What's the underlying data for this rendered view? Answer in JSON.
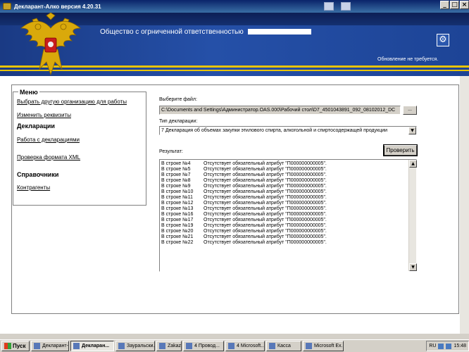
{
  "window": {
    "title": "Декларант-Алко версия 4.20.31",
    "controls": {
      "minimize": "_",
      "maximize": "□",
      "close": "×"
    }
  },
  "header": {
    "org_prefix": "Общество с огрниченной ответственностью",
    "update_status": "Обновление не требуется."
  },
  "menu": {
    "legend": "Меню",
    "items": [
      {
        "label": "Выбрать другую организацию для работы",
        "type": "link"
      },
      {
        "label": "Изменить реквизиты",
        "type": "link"
      },
      {
        "label": "Декларации",
        "type": "heading"
      },
      {
        "label": "Работа с декларациями",
        "type": "link"
      },
      {
        "label": "Проверка формата XML",
        "type": "link"
      },
      {
        "label": "Справочники",
        "type": "heading"
      },
      {
        "label": "Контрагенты",
        "type": "link"
      }
    ]
  },
  "form": {
    "file_label": "Выберите файл:",
    "file_value": "C:\\Documents and Settings\\Администратор.OAS.000\\Рабочий стол\\D7_4501043891_092_08102012_DC",
    "browse_label": "...",
    "type_label": "Тип декларации:",
    "type_value": "7 Декларация об объемах закупки этилового спирта, алкогольной и спиртосодержащей продукции",
    "results_label": "Результат:",
    "check_button": "Проверить"
  },
  "results": [
    {
      "row": "В строке №4",
      "message": "Отсутствует обязательный атрибут \"П000000000005\"."
    },
    {
      "row": "В строке №5",
      "message": "Отсутствует обязательный атрибут \"П000000000005\"."
    },
    {
      "row": "В строке №7",
      "message": "Отсутствует обязательный атрибут \"П000000000005\"."
    },
    {
      "row": "В строке №8",
      "message": "Отсутствует обязательный атрибут \"П000000000005\"."
    },
    {
      "row": "В строке №9",
      "message": "Отсутствует обязательный атрибут \"П000000000005\"."
    },
    {
      "row": "В строке №10",
      "message": "Отсутствует обязательный атрибут \"П000000000005\"."
    },
    {
      "row": "В строке №11",
      "message": "Отсутствует обязательный атрибут \"П000000000005\"."
    },
    {
      "row": "В строке №12",
      "message": "Отсутствует обязательный атрибут \"П000000000005\"."
    },
    {
      "row": "В строке №13",
      "message": "Отсутствует обязательный атрибут \"П000000000005\"."
    },
    {
      "row": "В строке №16",
      "message": "Отсутствует обязательный атрибут \"П000000000005\"."
    },
    {
      "row": "В строке №17",
      "message": "Отсутствует обязательный атрибут \"П000000000005\"."
    },
    {
      "row": "В строке №19",
      "message": "Отсутствует обязательный атрибут \"П000000000005\"."
    },
    {
      "row": "В строке №20",
      "message": "Отсутствует обязательный атрибут \"П000000000005\"."
    },
    {
      "row": "В строке №21",
      "message": "Отсутствует обязательный атрибут \"П000000000005\"."
    },
    {
      "row": "В строке №22",
      "message": "Отсутствует обязательный атрибут \"П000000000005\"."
    }
  ],
  "taskbar": {
    "start": "Пуск",
    "tasks": [
      {
        "label": "Декларант-...",
        "active": false
      },
      {
        "label": "Декларан...",
        "active": true
      },
      {
        "label": "Зауральски...",
        "active": false
      },
      {
        "label": "Zakaz",
        "active": false
      },
      {
        "label": "4 Провод...",
        "active": false
      },
      {
        "label": "4 Microsoft...",
        "active": false
      },
      {
        "label": "Касса",
        "active": false
      },
      {
        "label": "Microsoft Ex...",
        "active": false
      }
    ],
    "tray_lang": "RU",
    "clock": "15:48"
  },
  "colors": {
    "header_blue": "#2550a8",
    "stripe_yellow": "#e8c400",
    "title_bar": "#0a246a"
  }
}
